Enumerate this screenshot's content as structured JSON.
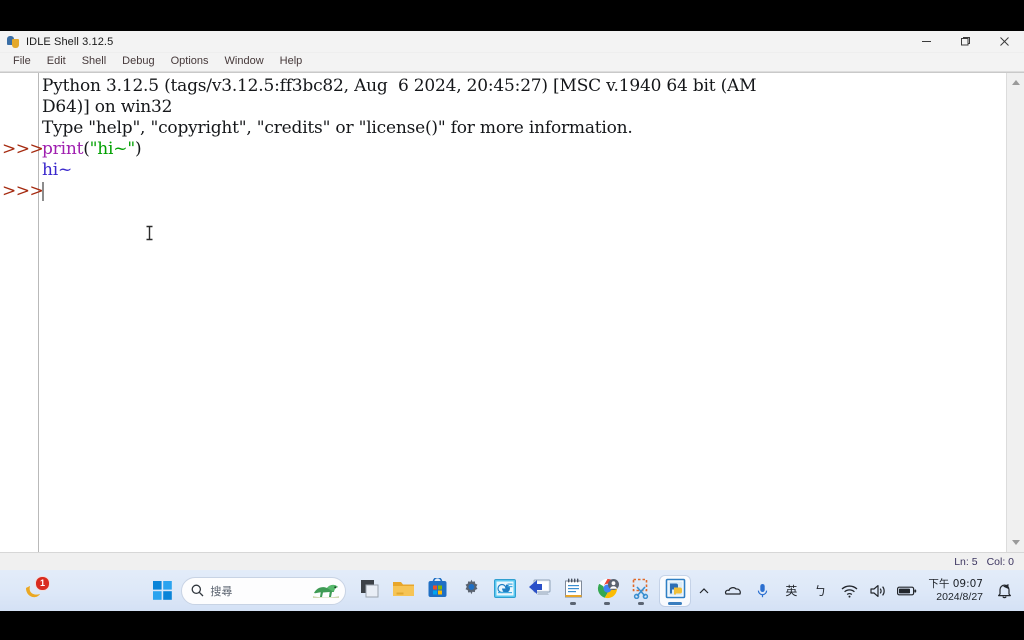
{
  "window": {
    "title": "IDLE Shell 3.12.5",
    "icon": "python-idle-icon",
    "controls": {
      "minimize": "minimize-button",
      "maximize": "maximize-restore-button",
      "close": "close-button"
    },
    "menus": [
      {
        "label": "File"
      },
      {
        "label": "Edit"
      },
      {
        "label": "Shell"
      },
      {
        "label": "Debug"
      },
      {
        "label": "Options"
      },
      {
        "label": "Window"
      },
      {
        "label": "Help"
      }
    ]
  },
  "shell": {
    "lines": [
      {
        "type": "output",
        "prompt": "",
        "segments": [
          {
            "text": "Python 3.12.5 (tags/v3.12.5:ff3bc82, Aug  6 2024, 20:45:27) [MSC v.1940 64 bit (AM",
            "cls": "tok-plain"
          }
        ]
      },
      {
        "type": "output",
        "prompt": "",
        "segments": [
          {
            "text": "D64)] on win32",
            "cls": "tok-plain"
          }
        ]
      },
      {
        "type": "output",
        "prompt": "",
        "segments": [
          {
            "text": "Type \"help\", \"copyright\", \"credits\" or \"license()\" for more information.",
            "cls": "tok-plain"
          }
        ]
      },
      {
        "type": "input",
        "prompt": ">>>",
        "segments": [
          {
            "text": "print",
            "cls": "tok-builtin"
          },
          {
            "text": "(",
            "cls": "tok-plain"
          },
          {
            "text": "\"hi~\"",
            "cls": "tok-string"
          },
          {
            "text": ")",
            "cls": "tok-plain"
          }
        ]
      },
      {
        "type": "output",
        "prompt": "",
        "segments": [
          {
            "text": "hi~",
            "cls": "tok-stdout"
          }
        ]
      },
      {
        "type": "input",
        "prompt": ">>>",
        "segments": [
          {
            "text": "",
            "cls": "tok-plain"
          }
        ]
      }
    ],
    "scrollbar": {
      "up_arrow": "scroll-up-arrow",
      "down_arrow": "scroll-down-arrow"
    }
  },
  "statusbar": {
    "line": "Ln: 5",
    "col": "Col: 0"
  },
  "taskbar": {
    "notification": {
      "name": "notification-bubble",
      "badge": "1"
    },
    "start": "start-button",
    "search": {
      "placeholder": "搜尋",
      "icon": "search-icon",
      "mascot": "dragon-mascot-icon"
    },
    "buttons": [
      {
        "name": "task-view-button",
        "icon": "task-view-icon"
      },
      {
        "name": "file-explorer-button",
        "icon": "folder-icon"
      },
      {
        "name": "microsoft-store-button",
        "icon": "store-bag-icon"
      },
      {
        "name": "settings-button",
        "icon": "gear-icon"
      },
      {
        "name": "presentation-app-button",
        "icon": "slide-chart-icon"
      },
      {
        "name": "remote-desktop-button",
        "icon": "monitor-arrow-icon"
      },
      {
        "name": "notepad-button",
        "icon": "notepad-icon"
      },
      {
        "name": "chrome-button",
        "icon": "chrome-icon"
      },
      {
        "name": "snipping-tool-button",
        "icon": "scissors-icon"
      },
      {
        "name": "idle-shell-button",
        "icon": "python-idle-icon"
      }
    ],
    "tray": {
      "overflow": "^",
      "items": [
        {
          "name": "hidden-icons-chevron",
          "glyph": "^"
        },
        {
          "name": "cloud-sync-icon",
          "glyph": ""
        },
        {
          "name": "microphone-icon",
          "glyph": ""
        },
        {
          "name": "input-language-indicator",
          "glyph": "英"
        },
        {
          "name": "bopomofo-indicator",
          "glyph": "ㄅ"
        },
        {
          "name": "wifi-icon",
          "glyph": ""
        },
        {
          "name": "volume-icon",
          "glyph": ""
        },
        {
          "name": "battery-icon",
          "glyph": ""
        }
      ],
      "clock": {
        "time": "下午 09:07",
        "date": "2024/8/27"
      },
      "notification_bell": "notification-bell-icon"
    }
  },
  "colors": {
    "prompt": "#a52a0f",
    "builtin": "#a020b0",
    "string": "#00a000",
    "stdout": "#3a28cc",
    "taskbar": "#dde8f8",
    "badge": "#d92b1f"
  }
}
